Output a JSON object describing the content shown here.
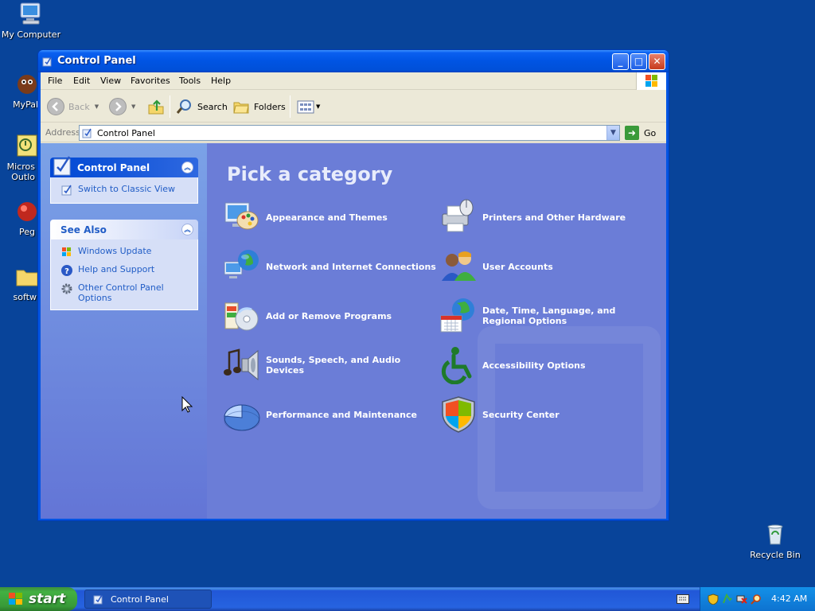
{
  "desktop": {
    "icons": [
      {
        "label": "My Computer"
      },
      {
        "label": "MyPal"
      },
      {
        "label": "Micros\nOutlo"
      },
      {
        "label": "Peg"
      },
      {
        "label": "softw"
      },
      {
        "label": "Recycle Bin"
      }
    ]
  },
  "window": {
    "title": "Control Panel",
    "menu": [
      "File",
      "Edit",
      "View",
      "Favorites",
      "Tools",
      "Help"
    ],
    "toolbar": {
      "back": "Back",
      "search": "Search",
      "folders": "Folders"
    },
    "address": {
      "label": "Address",
      "value": "Control Panel",
      "go": "Go"
    }
  },
  "taskpane": {
    "control_panel": {
      "title": "Control Panel",
      "links": [
        "Switch to Classic View"
      ]
    },
    "see_also": {
      "title": "See Also",
      "links": [
        "Windows Update",
        "Help and Support",
        "Other Control Panel Options"
      ]
    }
  },
  "categories": {
    "title": "Pick a category",
    "items": [
      {
        "label": "Appearance and Themes",
        "icon": "appearance-themes-icon"
      },
      {
        "label": "Printers and Other Hardware",
        "icon": "printers-hardware-icon"
      },
      {
        "label": "Network and Internet Connections",
        "icon": "network-internet-icon"
      },
      {
        "label": "User Accounts",
        "icon": "user-accounts-icon"
      },
      {
        "label": "Add or Remove Programs",
        "icon": "add-remove-programs-icon"
      },
      {
        "label": "Date, Time, Language, and Regional Options",
        "icon": "date-time-language-icon"
      },
      {
        "label": "Sounds, Speech, and Audio Devices",
        "icon": "sounds-speech-audio-icon"
      },
      {
        "label": "Accessibility Options",
        "icon": "accessibility-icon"
      },
      {
        "label": "Performance and Maintenance",
        "icon": "performance-maintenance-icon"
      },
      {
        "label": "Security Center",
        "icon": "security-center-icon"
      }
    ]
  },
  "taskbar": {
    "start": "start",
    "task_item": "Control Panel",
    "clock": "4:42 AM"
  },
  "colors": {
    "desktop": "#08449a",
    "titlebar": "#0054e3",
    "category_area": "#6b7dd7",
    "taskpane_link": "#215dc6",
    "start_green": "#43b042"
  }
}
